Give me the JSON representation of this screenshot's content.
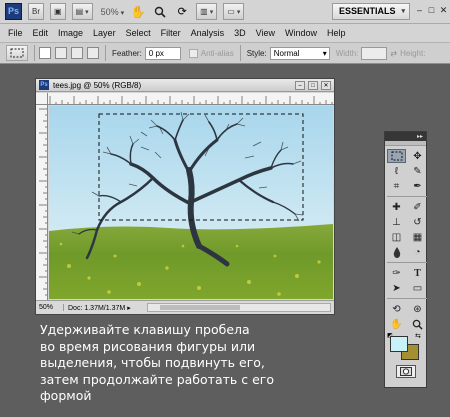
{
  "app_bar": {
    "logo_text": "Ps",
    "zoom_value": "50%",
    "workspace_label": "ESSENTIALS",
    "icons": [
      "bridge-icon",
      "mini-bridge-icon",
      "view-extras-icon",
      "hand-icon",
      "zoom-icon",
      "rotate-view-icon",
      "arrange-documents-icon",
      "screen-mode-icon",
      "workspace-caret-icon",
      "minimize-icon",
      "maximize-icon",
      "close-icon"
    ],
    "window_controls": [
      "–",
      "□",
      "✕"
    ]
  },
  "menu": {
    "items": [
      "File",
      "Edit",
      "Image",
      "Layer",
      "Select",
      "Filter",
      "Analysis",
      "3D",
      "View",
      "Window",
      "Help"
    ]
  },
  "options_bar": {
    "feather_label": "Feather:",
    "feather_value": "0 px",
    "antialias_label": "Anti-alias",
    "style_label": "Style:",
    "style_value": "Normal",
    "width_label": "Width:",
    "height_label": "Height:"
  },
  "document": {
    "title": "tees.jpg @ 50% (RGB/8)",
    "zoom": "50%",
    "doc_size": "Doc: 1.37M/1.37M",
    "icon": "ps-document-icon"
  },
  "tools_panel": {
    "header_glyph": "▸▸",
    "tools": [
      {
        "icon": "rectangular-marquee-icon",
        "glyph": "⬚",
        "active": true
      },
      {
        "icon": "move-tool-icon",
        "glyph": "✥"
      },
      {
        "icon": "lasso-icon",
        "glyph": "ℓ"
      },
      {
        "icon": "quick-selection-icon",
        "glyph": "✎"
      },
      {
        "icon": "crop-icon",
        "glyph": "⌗"
      },
      {
        "icon": "eyedropper-icon",
        "glyph": "✒"
      },
      {
        "icon": "spot-healing-icon",
        "glyph": "✚"
      },
      {
        "icon": "brush-icon",
        "glyph": "✐"
      },
      {
        "icon": "clone-stamp-icon",
        "glyph": "⊥"
      },
      {
        "icon": "history-brush-icon",
        "glyph": "↺"
      },
      {
        "icon": "eraser-icon",
        "glyph": "◫"
      },
      {
        "icon": "gradient-icon",
        "glyph": "▦"
      },
      {
        "icon": "blur-icon",
        "glyph": "💧"
      },
      {
        "icon": "dodge-icon",
        "glyph": "◔"
      },
      {
        "icon": "pen-icon",
        "glyph": "✑"
      },
      {
        "icon": "type-icon",
        "glyph": "T"
      },
      {
        "icon": "path-selection-icon",
        "glyph": "➤"
      },
      {
        "icon": "shape-icon",
        "glyph": "▭"
      },
      {
        "icon": "3d-rotate-icon",
        "glyph": "⟲"
      },
      {
        "icon": "3d-orbit-icon",
        "glyph": "⊛"
      },
      {
        "icon": "hand-tool-icon",
        "glyph": "✋"
      },
      {
        "icon": "zoom-tool-icon",
        "glyph": "🔍"
      }
    ],
    "foreground_color": "#c8f2f8",
    "background_color": "#a49033",
    "swatch_reset_glyph": "◩",
    "swatch_swap_glyph": "⇆"
  },
  "caption": {
    "lines": [
      "Удерживайте клавишу пробела",
      "во время рисования фигуры или",
      "выделения, чтобы подвинуть его,",
      "затем продолжайте работать с его",
      "формой"
    ]
  }
}
